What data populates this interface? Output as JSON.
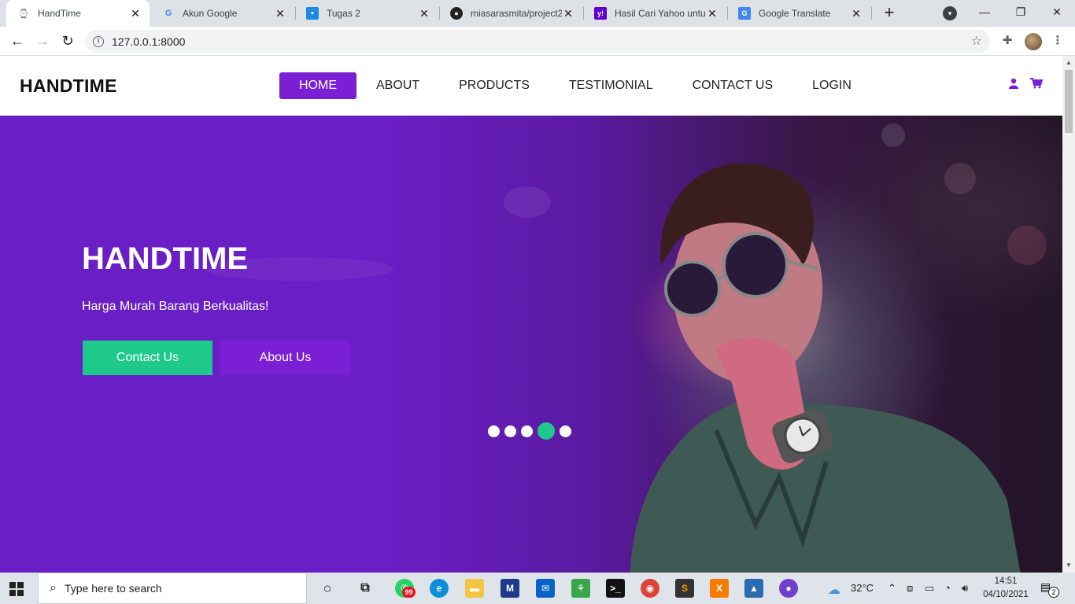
{
  "browser": {
    "tabs": [
      {
        "title": "HandTime",
        "active": true
      },
      {
        "title": "Akun Google",
        "active": false
      },
      {
        "title": "Tugas 2",
        "active": false
      },
      {
        "title": "miasarasmita/project2",
        "active": false
      },
      {
        "title": "Hasil Cari Yahoo untuk",
        "active": false
      },
      {
        "title": "Google Translate",
        "active": false
      }
    ],
    "new_tab": "+",
    "url": "127.0.0.1:8000"
  },
  "site": {
    "brand": "HANDTIME",
    "menu": [
      "HOME",
      "ABOUT",
      "PRODUCTS",
      "TESTIMONIAL",
      "CONTACT US",
      "LOGIN"
    ],
    "active_menu": "HOME",
    "accent_color": "#7a1fd4",
    "hero": {
      "title": "HANDTIME",
      "subtitle": "Harga Murah Barang Berkualitas!",
      "primary_button": "Contact Us",
      "secondary_button": "About Us",
      "primary_color": "#1ec98b",
      "slides_total": 5,
      "slide_active": 4
    }
  },
  "taskbar": {
    "search_placeholder": "Type here to search",
    "weather": "32°C",
    "time": "14:51",
    "date": "04/10/2021",
    "whatsapp_badge": "99",
    "notifications": "2"
  }
}
